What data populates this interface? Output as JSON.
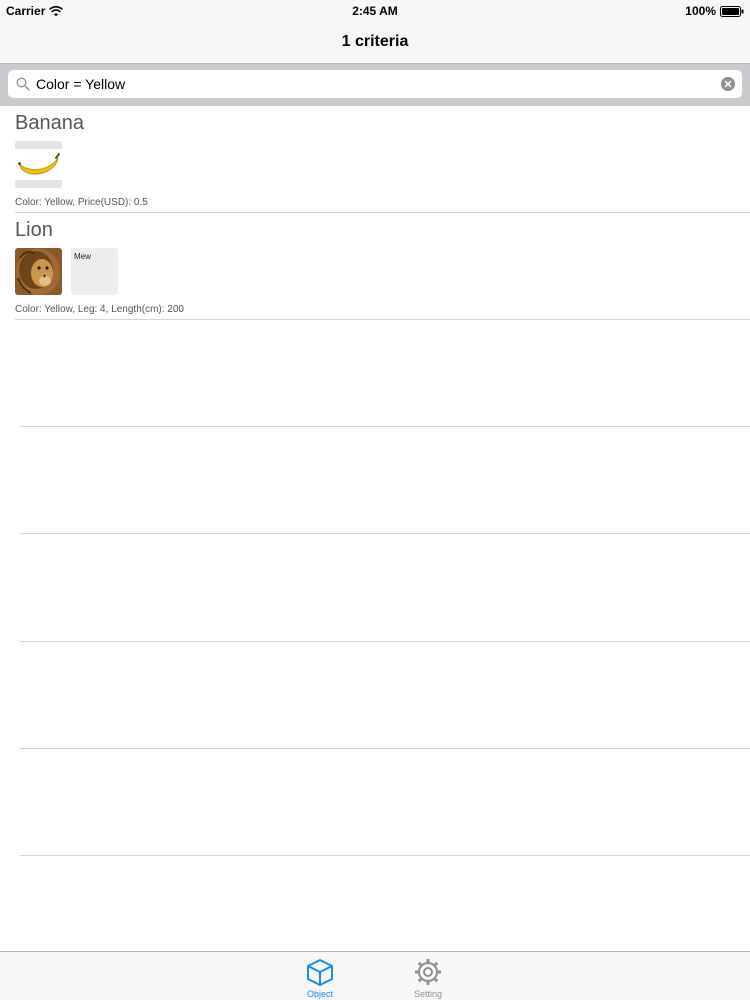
{
  "status_bar": {
    "carrier": "Carrier",
    "time": "2:45 AM",
    "battery": "100%"
  },
  "nav": {
    "title": "1 criteria"
  },
  "search": {
    "value": "Color = Yellow",
    "placeholder": ""
  },
  "items": [
    {
      "title": "Banana",
      "subtitle": "Color: Yellow, Price(USD): 0.5",
      "thumbnails": [
        ""
      ]
    },
    {
      "title": "Lion",
      "subtitle": "Color: Yellow, Leg: 4, Length(cm): 200",
      "thumbnails": [
        "",
        "Mew"
      ]
    }
  ],
  "tabs": [
    {
      "label": "Object",
      "icon": "cube-icon",
      "selected": true
    },
    {
      "label": "Setting",
      "icon": "gear-icon",
      "selected": false
    }
  ],
  "colors": {
    "accent": "#1a8be0",
    "inactive": "#8e8e93",
    "separator": "#d6d6d6",
    "search_bar_bg": "#c9c9ce"
  }
}
